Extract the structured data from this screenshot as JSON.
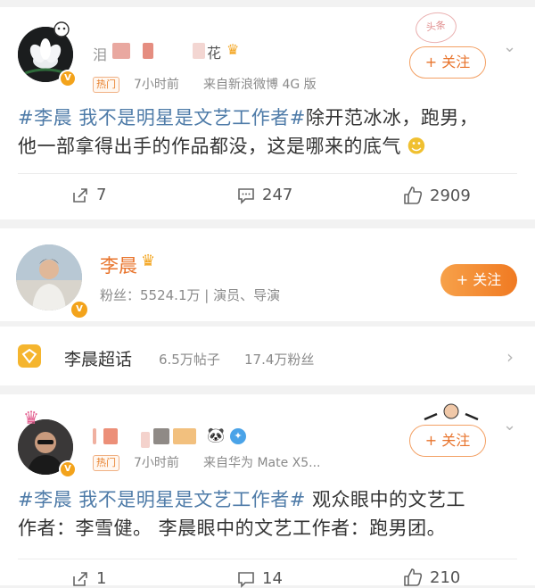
{
  "post1": {
    "name_fragments": [
      "泪",
      "花"
    ],
    "hot_tag": "热门",
    "time": "7小时前",
    "source": "来自新浪微博 4G 版",
    "follow_label": "+ 关注",
    "topic": "#李晨 我不是明星是文艺工作者#",
    "text_line1_rest": "除开范冰冰，跑男，",
    "text_line2": "他一部拿得出手的作品都没，这是哪来的底气",
    "reposts": "7",
    "comments": "247",
    "likes": "2909"
  },
  "profile": {
    "name": "李晨",
    "followers": "粉丝：5524.1万 | 演员、导演",
    "follow_label": "+ 关注"
  },
  "topic_card": {
    "title": "李晨超话",
    "posts": "6.5万帖子",
    "fans": "17.4万粉丝"
  },
  "post2": {
    "hot_tag": "热门",
    "time": "7小时前",
    "source": "来自华为 Mate X5...",
    "follow_label": "+ 关注",
    "topic": "#李晨 我不是明星是文艺工作者#",
    "text_line1_rest": " 观众眼中的文艺工",
    "text_line2": "作者：李雪健。 李晨眼中的文艺工作者：跑男团。",
    "reposts": "1",
    "comments": "14",
    "likes": "210"
  },
  "colors": {
    "accent_orange": "#f08a24",
    "topic_blue": "#4e7ba8",
    "meta_gray": "#8a8a8a"
  },
  "icons": [
    "lotus-avatar",
    "verified-badge",
    "crown-icon",
    "repost-icon",
    "comment-icon",
    "like-icon",
    "chevron-down-icon",
    "supertopic-icon",
    "chevron-right-icon",
    "panda-icon"
  ]
}
